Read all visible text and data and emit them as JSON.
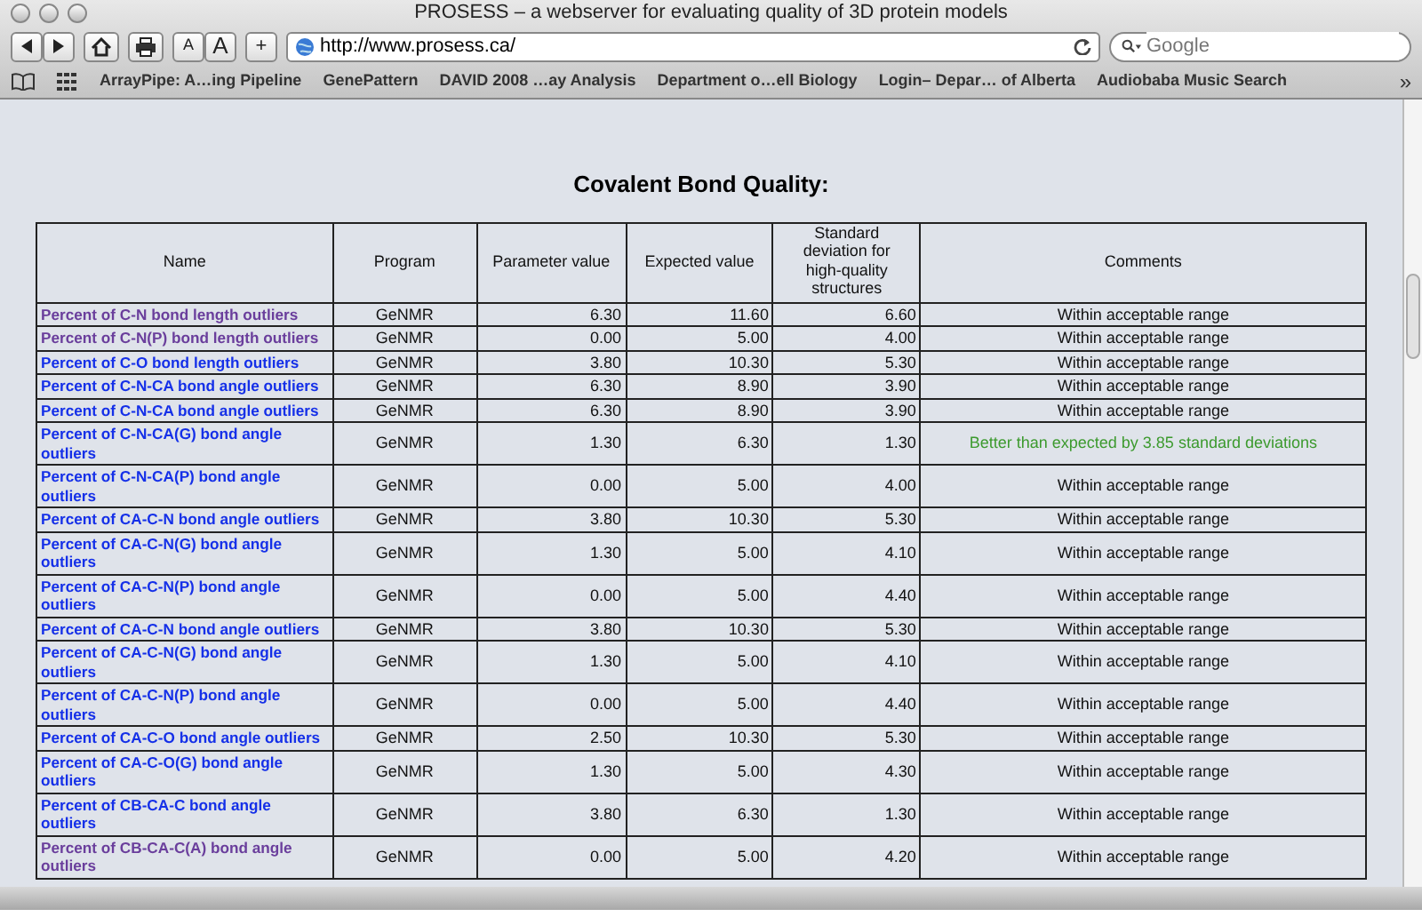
{
  "window": {
    "title": "PROSESS – a webserver for evaluating quality of 3D protein models"
  },
  "toolbar": {
    "text_size_buttons": [
      "A",
      "A"
    ],
    "add_button": "+",
    "url": "http://www.prosess.ca/",
    "search": {
      "placeholder": "Google"
    }
  },
  "bookmarks": {
    "items": [
      "ArrayPipe: A…ing Pipeline",
      "GenePattern",
      "DAVID 2008 …ay Analysis",
      "Department o…ell Biology",
      "Login– Depar… of Alberta",
      "Audiobaba Music Search"
    ],
    "overflow": "»"
  },
  "page": {
    "heading": "Covalent Bond Quality:",
    "table": {
      "columns": [
        "Name",
        "Program",
        "Parameter value",
        "Expected value",
        "Standard deviation for high-quality structures",
        "Comments"
      ],
      "rows": [
        {
          "name": "Percent of C-N bond length outliers",
          "visited": true,
          "program": "GeNMR",
          "parameter": "6.30",
          "expected": "11.60",
          "sd": "6.60",
          "comment": "Within acceptable range",
          "kind": "normal"
        },
        {
          "name": "Percent of C-N(P) bond length outliers",
          "visited": true,
          "program": "GeNMR",
          "parameter": "0.00",
          "expected": "5.00",
          "sd": "4.00",
          "comment": "Within acceptable range",
          "kind": "normal"
        },
        {
          "name": "Percent of C-O bond length outliers",
          "visited": false,
          "program": "GeNMR",
          "parameter": "3.80",
          "expected": "10.30",
          "sd": "5.30",
          "comment": "Within acceptable range",
          "kind": "normal"
        },
        {
          "name": "Percent of C-N-CA bond angle outliers",
          "visited": false,
          "program": "GeNMR",
          "parameter": "6.30",
          "expected": "8.90",
          "sd": "3.90",
          "comment": "Within acceptable range",
          "kind": "normal"
        },
        {
          "name": "Percent of C-N-CA bond angle outliers",
          "visited": false,
          "program": "GeNMR",
          "parameter": "6.30",
          "expected": "8.90",
          "sd": "3.90",
          "comment": "Within acceptable range",
          "kind": "normal"
        },
        {
          "name": "Percent of C-N-CA(G) bond angle outliers",
          "visited": false,
          "program": "GeNMR",
          "parameter": "1.30",
          "expected": "6.30",
          "sd": "1.30",
          "comment": "Better than expected by 3.85 standard deviations",
          "kind": "good"
        },
        {
          "name": "Percent of C-N-CA(P) bond angle outliers",
          "visited": false,
          "program": "GeNMR",
          "parameter": "0.00",
          "expected": "5.00",
          "sd": "4.00",
          "comment": "Within acceptable range",
          "kind": "normal"
        },
        {
          "name": "Percent of CA-C-N bond angle outliers",
          "visited": false,
          "program": "GeNMR",
          "parameter": "3.80",
          "expected": "10.30",
          "sd": "5.30",
          "comment": "Within acceptable range",
          "kind": "normal"
        },
        {
          "name": "Percent of CA-C-N(G) bond angle outliers",
          "visited": false,
          "program": "GeNMR",
          "parameter": "1.30",
          "expected": "5.00",
          "sd": "4.10",
          "comment": "Within acceptable range",
          "kind": "normal"
        },
        {
          "name": "Percent of CA-C-N(P) bond angle outliers",
          "visited": false,
          "program": "GeNMR",
          "parameter": "0.00",
          "expected": "5.00",
          "sd": "4.40",
          "comment": "Within acceptable range",
          "kind": "normal"
        },
        {
          "name": "Percent of CA-C-N bond angle outliers",
          "visited": false,
          "program": "GeNMR",
          "parameter": "3.80",
          "expected": "10.30",
          "sd": "5.30",
          "comment": "Within acceptable range",
          "kind": "normal"
        },
        {
          "name": "Percent of CA-C-N(G) bond angle outliers",
          "visited": false,
          "program": "GeNMR",
          "parameter": "1.30",
          "expected": "5.00",
          "sd": "4.10",
          "comment": "Within acceptable range",
          "kind": "normal"
        },
        {
          "name": "Percent of CA-C-N(P) bond angle outliers",
          "visited": false,
          "program": "GeNMR",
          "parameter": "0.00",
          "expected": "5.00",
          "sd": "4.40",
          "comment": "Within acceptable range",
          "kind": "normal"
        },
        {
          "name": "Percent of CA-C-O bond angle outliers",
          "visited": false,
          "program": "GeNMR",
          "parameter": "2.50",
          "expected": "10.30",
          "sd": "5.30",
          "comment": "Within acceptable range",
          "kind": "normal"
        },
        {
          "name": "Percent of CA-C-O(G) bond angle outliers",
          "visited": false,
          "program": "GeNMR",
          "parameter": "1.30",
          "expected": "5.00",
          "sd": "4.30",
          "comment": "Within acceptable range",
          "kind": "normal"
        },
        {
          "name": "Percent of CB-CA-C bond angle outliers",
          "visited": false,
          "program": "GeNMR",
          "parameter": "3.80",
          "expected": "6.30",
          "sd": "1.30",
          "comment": "Within acceptable range",
          "kind": "normal"
        },
        {
          "name": "Percent of CB-CA-C(A) bond angle outliers",
          "visited": true,
          "program": "GeNMR",
          "parameter": "0.00",
          "expected": "5.00",
          "sd": "4.20",
          "comment": "Within acceptable range",
          "kind": "normal"
        }
      ]
    }
  }
}
